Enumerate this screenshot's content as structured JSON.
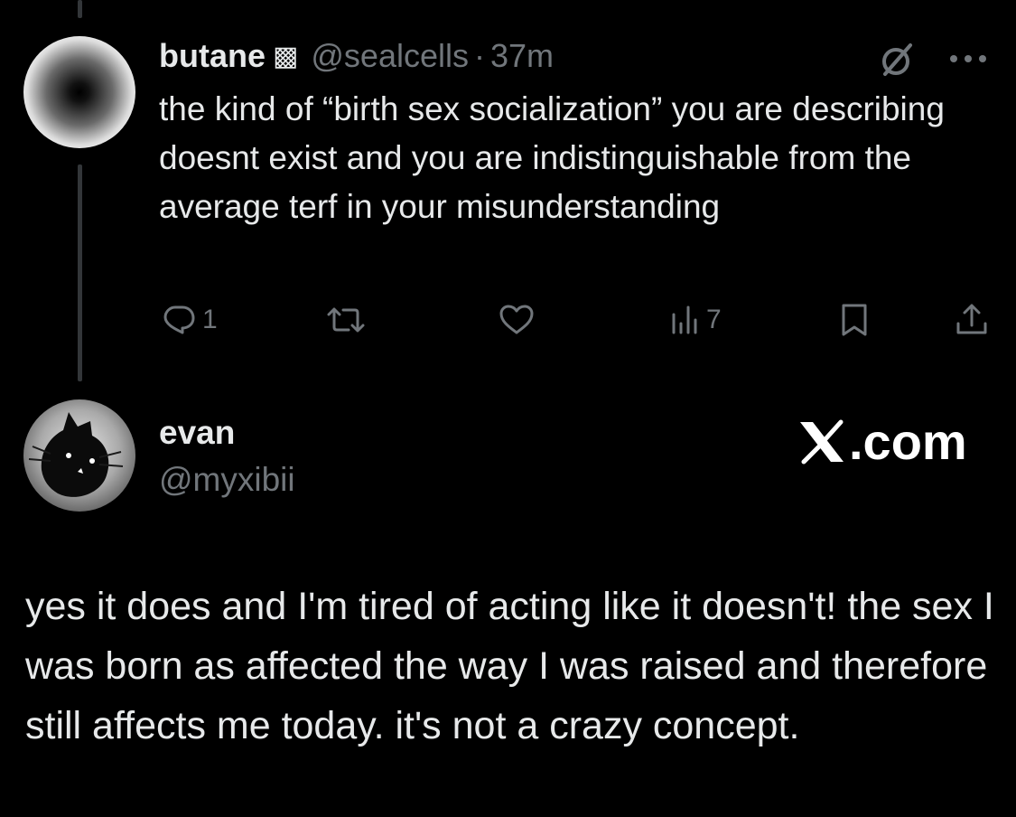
{
  "parent_tweet": {
    "display_name": "butane",
    "name_badge": "▩",
    "handle": "@sealcells",
    "separator": "·",
    "time": "37m",
    "text": "the kind of “birth sex socialization” you are describing doesnt exist and you are indistinguishable from the average terf in your misunderstanding",
    "actions": {
      "replies": "1",
      "reposts": "",
      "likes": "",
      "views": "7"
    }
  },
  "reply_tweet": {
    "display_name": "evan",
    "handle": "@myxibii",
    "text": "yes it does and I'm tired of acting like it doesn't! the sex I was born as affected the way I was raised and therefore still affects me today. it's not a crazy concept."
  },
  "brand": {
    "suffix": ".com"
  },
  "colors": {
    "background": "#000000",
    "primary_text": "#e7e9ea",
    "secondary_text": "#71767b",
    "thread_line": "#333639"
  },
  "icons": [
    "grok-icon",
    "more-icon",
    "reply-icon",
    "repost-icon",
    "like-icon",
    "views-icon",
    "bookmark-icon",
    "share-icon",
    "x-logo-icon",
    "cat-avatar"
  ]
}
